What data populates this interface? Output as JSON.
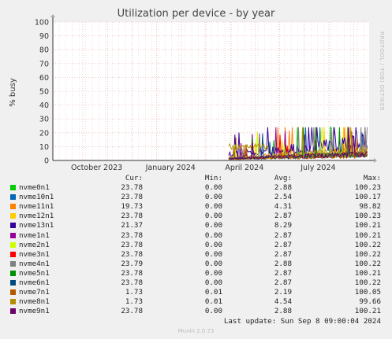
{
  "chart_data": {
    "type": "line",
    "title": "Utilization per device - by year",
    "ylabel": "% busy",
    "ylim": [
      0,
      100
    ],
    "yticks": [
      0,
      10,
      20,
      30,
      40,
      50,
      60,
      70,
      80,
      90,
      100
    ],
    "xticks": [
      "October 2023",
      "January 2024",
      "April 2024",
      "July 2024"
    ],
    "grid": true,
    "watermark": "RRDTOOL / TOBI OETIKER",
    "footer": "Munin 2.0.73",
    "legend_headers": [
      "Cur:",
      "Min:",
      "Avg:",
      "Max:"
    ],
    "series": [
      {
        "name": "nvme0n1",
        "color": "#00cc00",
        "cur": "23.78",
        "min": "0.00",
        "avg": "2.88",
        "max": "100.23"
      },
      {
        "name": "nvme10n1",
        "color": "#0066b3",
        "cur": "23.78",
        "min": "0.00",
        "avg": "2.54",
        "max": "100.17"
      },
      {
        "name": "nvme11n1",
        "color": "#ff8000",
        "cur": "19.73",
        "min": "0.00",
        "avg": "4.31",
        "max": "98.82"
      },
      {
        "name": "nvme12n1",
        "color": "#ffcc00",
        "cur": "23.78",
        "min": "0.00",
        "avg": "2.87",
        "max": "100.23"
      },
      {
        "name": "nvme13n1",
        "color": "#330099",
        "cur": "21.37",
        "min": "0.00",
        "avg": "8.29",
        "max": "100.21"
      },
      {
        "name": "nvme1n1",
        "color": "#990099",
        "cur": "23.78",
        "min": "0.00",
        "avg": "2.87",
        "max": "100.21"
      },
      {
        "name": "nvme2n1",
        "color": "#ccff00",
        "cur": "23.78",
        "min": "0.00",
        "avg": "2.87",
        "max": "100.22"
      },
      {
        "name": "nvme3n1",
        "color": "#ff0000",
        "cur": "23.78",
        "min": "0.00",
        "avg": "2.87",
        "max": "100.22"
      },
      {
        "name": "nvme4n1",
        "color": "#808080",
        "cur": "23.79",
        "min": "0.00",
        "avg": "2.88",
        "max": "100.22"
      },
      {
        "name": "nvme5n1",
        "color": "#008f00",
        "cur": "23.78",
        "min": "0.00",
        "avg": "2.87",
        "max": "100.21"
      },
      {
        "name": "nvme6n1",
        "color": "#00487d",
        "cur": "23.78",
        "min": "0.00",
        "avg": "2.87",
        "max": "100.22"
      },
      {
        "name": "nvme7n1",
        "color": "#b35a00",
        "cur": "1.73",
        "min": "0.01",
        "avg": "2.19",
        "max": "100.05"
      },
      {
        "name": "nvme8n1",
        "color": "#b38f00",
        "cur": "1.73",
        "min": "0.01",
        "avg": "4.54",
        "max": "99.66"
      },
      {
        "name": "nvme9n1",
        "color": "#6b006b",
        "cur": "23.78",
        "min": "0.00",
        "avg": "2.88",
        "max": "100.21"
      }
    ]
  },
  "last_update": "Last update: Sun Sep  8 09:00:04 2024"
}
